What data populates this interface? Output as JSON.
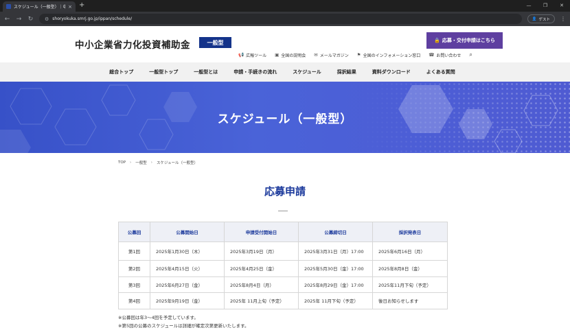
{
  "browser": {
    "tab_title": "スケジュール（一般型）｜中小企",
    "tab_close": "×",
    "newtab": "+",
    "win": [
      "—",
      "❐",
      "✕"
    ],
    "url": "shoryokuka.smrj.go.jp/ippan/schedule/",
    "guest_label": "ゲスト"
  },
  "header": {
    "site_title": "中小企業省力化投資補助金",
    "badge": "一般型",
    "apply_button": "応募・交付申請はこちら",
    "util_links": [
      "広報ツール",
      "全国の説明会",
      "メールマガジン",
      "全国のインフォメーション窓口",
      "お問い合わせ"
    ]
  },
  "nav": [
    "総合トップ",
    "一般型トップ",
    "一般型とは",
    "申請・手続きの流れ",
    "スケジュール",
    "採択結果",
    "資料ダウンロード",
    "よくある質問"
  ],
  "hero": {
    "title": "スケジュール（一般型）"
  },
  "breadcrumb": [
    "TOP",
    "一般型",
    "スケジュール（一般型）"
  ],
  "section": {
    "title": "応募申請"
  },
  "table": {
    "headers": [
      "公募回",
      "公募開始日",
      "申請受付開始日",
      "公募締切日",
      "採択発表日"
    ],
    "rows": [
      [
        "第1回",
        "2025年1月30日（木）",
        "2025年3月19日（月）",
        "2025年3月31日（月）17:00",
        "2025年6月16日（月）"
      ],
      [
        "第2回",
        "2025年4月15日（火）",
        "2025年4月25日（金）",
        "2025年5月30日（金）17:00",
        "2025年8月8日（金）"
      ],
      [
        "第3回",
        "2025年6月27日（金）",
        "2025年8月4日（月）",
        "2025年8月29日（金）17:00",
        "2025年11月下旬（予定）"
      ],
      [
        "第4回",
        "2025年9月19日（金）",
        "2025年 11月上旬（予定）",
        "2025年 11月下旬（予定）",
        "後日お知らせします"
      ]
    ]
  },
  "notes": [
    "※公募回は年3～4回を予定しています。",
    "※第5回の公募のスケジュールは詳細が確定次第更新いたします。"
  ],
  "colors": {
    "brand_navy": "#14338a",
    "apply_purple": "#5e3fa0",
    "hero_blue": "#4a63d8"
  }
}
